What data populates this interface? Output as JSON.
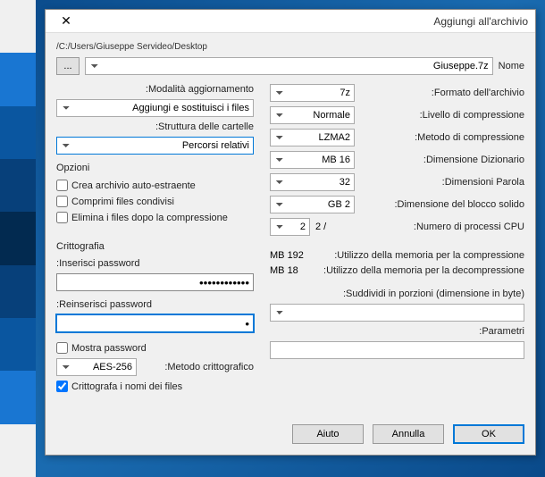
{
  "title": "Aggiungi all'archivio",
  "path": "C:/Users/Giuseppe Servideo/Desktop/",
  "name_label": "Nome",
  "filename": "Giuseppe.7z",
  "browse": "...",
  "left": {
    "format_label": "Formato dell'archivio:",
    "format_value": "7z",
    "level_label": "Livello di compressione:",
    "level_value": "Normale",
    "method_label": "Metodo di compressione:",
    "method_value": "LZMA2",
    "dict_label": "Dimensione Dizionario:",
    "dict_value": "16 MB",
    "word_label": "Dimensioni Parola:",
    "word_value": "32",
    "solid_label": "Dimensione del blocco solido:",
    "solid_value": "2 GB",
    "cpu_label": "Numero di processi CPU:",
    "cpu_value": "2",
    "cpu_total": "/ 2",
    "mem_comp_label": "Utilizzo della memoria per la compressione:",
    "mem_comp_value": "192 MB",
    "mem_decomp_label": "Utilizzo della memoria per la decompressione:",
    "mem_decomp_value": "18 MB",
    "split_label": "Suddividi in porzioni (dimensione in byte):",
    "params_label": "Parametri:"
  },
  "right": {
    "update_label": "Modalità aggiornamento:",
    "update_value": "Aggiungi e sostituisci i files",
    "pathmode_label": "Struttura delle cartelle:",
    "pathmode_value": "Percorsi relativi",
    "options_title": "Opzioni",
    "sfx_label": "Crea archivio auto-estraente",
    "shared_label": "Comprimi files condivisi",
    "delete_label": "Elimina i files dopo la compressione",
    "crypto_title": "Crittografia",
    "pw_label": "Inserisci password:",
    "pw2_label": "Reinserisci password:",
    "showpw_label": "Mostra password",
    "encmethod_label": "Metodo crittografico:",
    "encmethod_value": "AES-256",
    "encnames_label": "Crittografa i nomi dei files"
  },
  "buttons": {
    "ok": "OK",
    "cancel": "Annulla",
    "help": "Aiuto"
  }
}
